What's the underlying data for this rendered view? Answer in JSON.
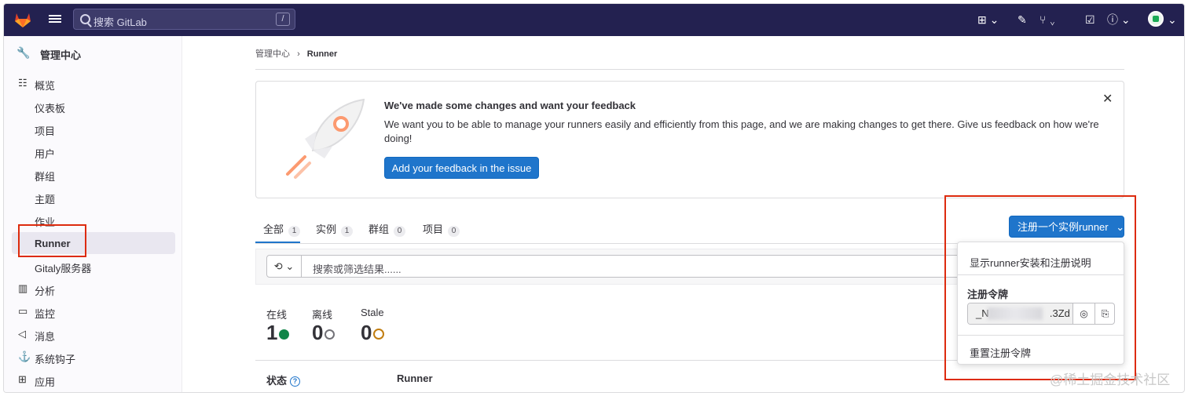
{
  "topbar": {
    "search_placeholder": "搜索 GitLab",
    "search_shortcut": "/"
  },
  "sidebar": {
    "title": "管理中心",
    "items": [
      {
        "label": "概览",
        "icon": "overview-icon"
      },
      {
        "label": "仪表板"
      },
      {
        "label": "项目"
      },
      {
        "label": "用户"
      },
      {
        "label": "群组"
      },
      {
        "label": "主题"
      },
      {
        "label": "作业"
      },
      {
        "label": "Runner"
      },
      {
        "label": "Gitaly服务器"
      },
      {
        "label": "分析",
        "icon": "analytics-icon"
      },
      {
        "label": "监控",
        "icon": "monitor-icon"
      },
      {
        "label": "消息",
        "icon": "messages-icon"
      },
      {
        "label": "系统钩子",
        "icon": "hook-icon"
      },
      {
        "label": "应用",
        "icon": "applications-icon"
      }
    ]
  },
  "breadcrumb": {
    "root": "管理中心",
    "sep": "›",
    "current": "Runner"
  },
  "banner": {
    "title": "We've made some changes and want your feedback",
    "description": "We want you to be able to manage your runners easily and efficiently from this page, and we are making changes to get there. Give us feedback on how we're doing!",
    "button": "Add your feedback in the issue",
    "close": "✕"
  },
  "tabs": [
    {
      "label": "全部",
      "count": "1"
    },
    {
      "label": "实例",
      "count": "1"
    },
    {
      "label": "群组",
      "count": "0"
    },
    {
      "label": "项目",
      "count": "0"
    }
  ],
  "filter": {
    "placeholder": "搜索或筛选结果......"
  },
  "stats": {
    "online": {
      "label": "在线",
      "value": "1"
    },
    "offline": {
      "label": "离线",
      "value": "0"
    },
    "stale": {
      "label": "Stale",
      "value": "0"
    }
  },
  "table": {
    "status_header": "状态",
    "runner_header": "Runner"
  },
  "register": {
    "button": "注册一个实例runner",
    "dropdown": {
      "show_instructions": "显示runner安装和注册说明",
      "token_label": "注册令牌",
      "token_prefix": "_N",
      "token_suffix": ".3Zd",
      "reset": "重置注册令牌"
    }
  },
  "watermark": "@稀土掘金技术社区",
  "colors": {
    "topbar": "#232150",
    "primary": "#1f75cb",
    "highlight": "#dd2b0e",
    "online": "#108548"
  }
}
